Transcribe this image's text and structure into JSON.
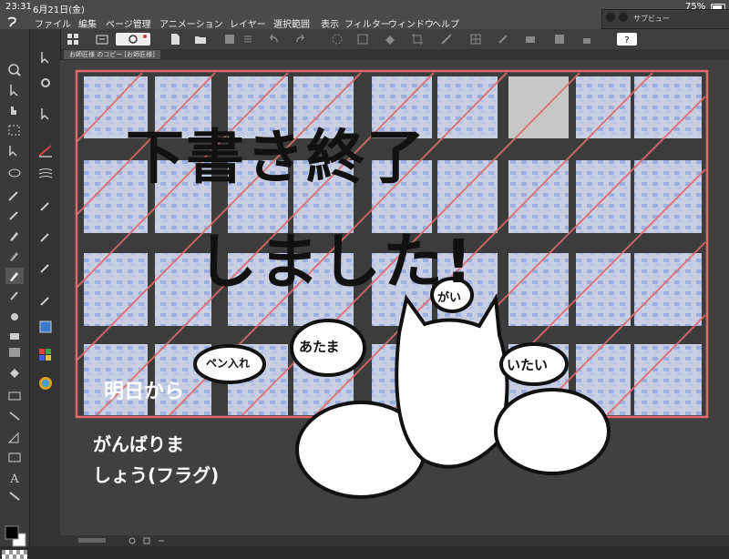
{
  "status": {
    "time": "23:31",
    "date": "6月21日(金)",
    "battery": "75%"
  },
  "menu": [
    "ファイル",
    "編集",
    "ページ管理",
    "アニメーション",
    "レイヤー",
    "選択範囲",
    "表示",
    "フィルター",
    "ウィンドウ",
    "ヘルプ"
  ],
  "subview": {
    "title": "サブビュー"
  },
  "tab": {
    "label": "お師匠様 のコピー [お師匠様]"
  },
  "drawing": {
    "headline_line1": "下書き終了",
    "headline_line2": "しました!",
    "bubble_left": "あたま",
    "bubble_top": "がい",
    "bubble_right": "いたい",
    "note_arrow": "ペン入れ",
    "left_text_1": "明日から",
    "left_text_2": "がんばりま",
    "left_text_3": "しょう(フラグ)"
  },
  "colors": {
    "accent_red": "#e06a6a",
    "panel_bg": "#3a3a3a",
    "canvas_bg": "#404040",
    "page_bg": "#d8d8d8"
  }
}
